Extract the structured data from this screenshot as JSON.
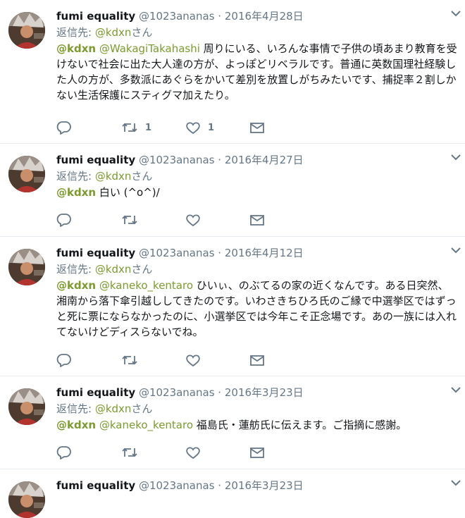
{
  "colors": {
    "link": "#7c9a2f",
    "meta": "#657786",
    "text": "#14171a",
    "divider": "#e6ecf0"
  },
  "tweets": [
    {
      "name": "fumi equality",
      "handle": "@1023ananas",
      "dot": "·",
      "date": "2016年4月28日",
      "reply_prefix": "返信先: ",
      "reply_user": "@kdxn",
      "reply_suffix": "さん",
      "mention1": "@kdxn",
      "mention2": "@WakagiTakahashi",
      "body": " 周りにいる、いろんな事情で子供の頃あまり教育を受けないで社会に出た大人達の方が、よっぽどリベラルです。普通に英数国理社経験した人の方が、多数派にあぐらをかいて差別を放置しがちみたいです、捕捉率２割しかない生活保護にスティグマ加えたり。",
      "retweets": "1",
      "likes": "1"
    },
    {
      "name": "fumi equality",
      "handle": "@1023ananas",
      "dot": "·",
      "date": "2016年4月27日",
      "reply_prefix": "返信先: ",
      "reply_user": "@kdxn",
      "reply_suffix": "さん",
      "mention1": "@kdxn",
      "mention2": "",
      "body": " 白い (^o^)/",
      "retweets": "",
      "likes": ""
    },
    {
      "name": "fumi equality",
      "handle": "@1023ananas",
      "dot": "·",
      "date": "2016年4月12日",
      "reply_prefix": "返信先: ",
      "reply_user": "@kdxn",
      "reply_suffix": "さん",
      "mention1": "@kdxn",
      "mention2": "@kaneko_kentaro",
      "body": " ひいぃ、のぶてるの家の近くなんです。ある日突然、湘南から落下傘引越ししてきたのです。いわさきちひろ氏のご縁で中選挙区ではずっと死に票にならなかったのに、小選挙区では今年こそ正念場です。あの一族には入れてないけどディスらないでね。",
      "retweets": "",
      "likes": ""
    },
    {
      "name": "fumi equality",
      "handle": "@1023ananas",
      "dot": "·",
      "date": "2016年3月23日",
      "reply_prefix": "返信先: ",
      "reply_user": "@kdxn",
      "reply_suffix": "さん",
      "mention1": "@kdxn",
      "mention2": "@kaneko_kentaro",
      "body": " 福島氏・蓮舫氏に伝えます。ご指摘に感謝。",
      "retweets": "",
      "likes": ""
    },
    {
      "name": "fumi equality",
      "handle": "@1023ananas",
      "dot": "·",
      "date": "2016年3月23日"
    }
  ]
}
